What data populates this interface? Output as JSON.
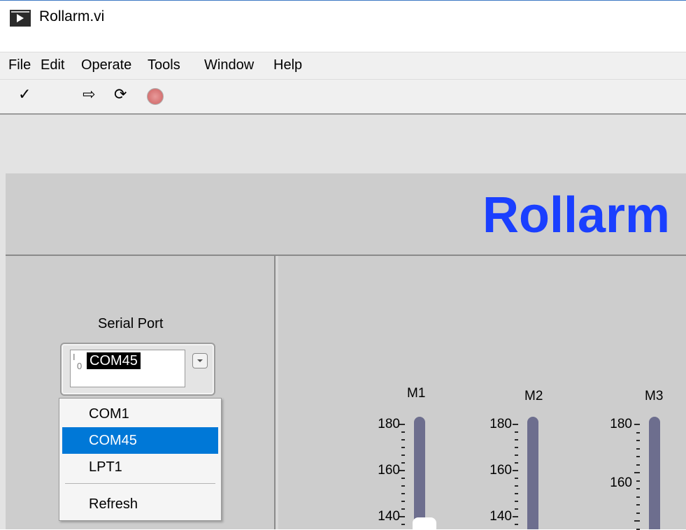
{
  "window": {
    "title": "Rollarm.vi"
  },
  "menu": [
    "File",
    "Edit",
    "Operate",
    "Tools",
    "Window",
    "Help"
  ],
  "toolbar": {
    "check_glyph": "✓",
    "run_glyph": "⇨",
    "run_cont_glyph": "⟳"
  },
  "banner": {
    "title": "Rollarm"
  },
  "serial": {
    "label": "Serial Port",
    "value": "COM45",
    "io_mark": "I/0",
    "options": [
      "COM1",
      "COM45",
      "LPT1"
    ],
    "selected": "COM45",
    "refresh": "Refresh"
  },
  "sliders": [
    {
      "name": "M1",
      "ticks": [
        "180",
        "160",
        "140"
      ]
    },
    {
      "name": "M2",
      "ticks": [
        "180",
        "160",
        "140"
      ]
    },
    {
      "name": "M3",
      "ticks": [
        "180",
        "160"
      ]
    }
  ],
  "colors": {
    "accent": "#1a3fff",
    "selection": "#0078d7",
    "track": "#6d6e8e"
  }
}
